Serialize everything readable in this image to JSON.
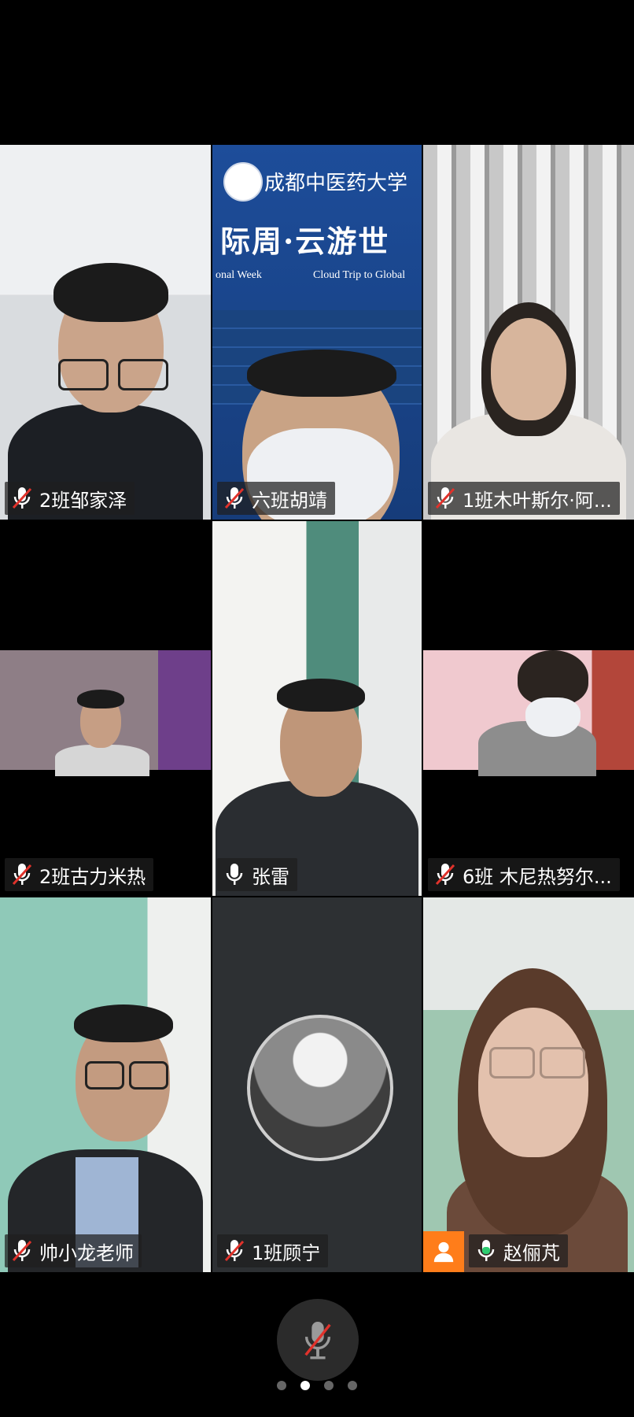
{
  "participants": [
    {
      "name": "2班邹家泽",
      "mic": "muted"
    },
    {
      "name": "六班胡靖",
      "mic": "muted"
    },
    {
      "name": "1班木叶斯尔·阿...",
      "mic": "muted"
    },
    {
      "name": "2班古力米热",
      "mic": "muted"
    },
    {
      "name": "张雷",
      "mic": "on"
    },
    {
      "name": "6班  木尼热努尔...",
      "mic": "muted"
    },
    {
      "name": "帅小龙老师",
      "mic": "muted"
    },
    {
      "name": "1班顾宁",
      "mic": "muted"
    },
    {
      "name": "赵俪芃",
      "mic": "speaking"
    }
  ],
  "poster": {
    "title": "际周·云游世",
    "subtitle_left": "onal Week",
    "subtitle_right": "Cloud Trip to Global",
    "university": "成都中医药大学"
  },
  "bottom": {
    "mute_icon": "mic-muted-icon",
    "page_count": 4,
    "active_page": 2
  },
  "colors": {
    "accent_green": "#2ecc71",
    "host_orange": "#ff7d1a",
    "muted_red": "#e0322b"
  }
}
